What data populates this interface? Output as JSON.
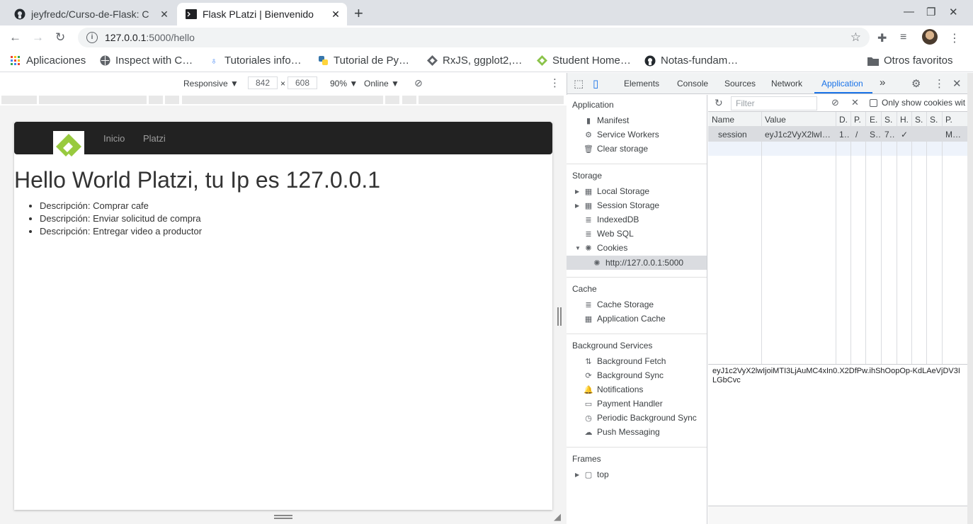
{
  "browser": {
    "tabs": [
      {
        "title": "jeyfredc/Curso-de-Flask: C",
        "icon": "github-icon",
        "active": false
      },
      {
        "title": "Flask PLatzi | Bienvenido",
        "icon": "terminal-icon",
        "active": true
      }
    ],
    "new_tab": "+",
    "url_host": "127.0.0.1",
    "url_path": ":5000/hello"
  },
  "bookmarks": [
    {
      "label": "Aplicaciones",
      "icon": "apps-grid-icon"
    },
    {
      "label": "Inspect with C…",
      "icon": "globe-icon"
    },
    {
      "label": "Tutoriales info…",
      "icon": "bulb-icon"
    },
    {
      "label": "Tutorial de Py…",
      "icon": "python-icon"
    },
    {
      "label": "RxJS, ggplot2,…",
      "icon": "diamond-icon"
    },
    {
      "label": "Student Home…",
      "icon": "student-diamond-icon"
    },
    {
      "label": "Notas-fundam…",
      "icon": "github-icon"
    },
    {
      "label": "Otros favoritos",
      "icon": "folder-icon"
    }
  ],
  "device_toolbar": {
    "mode": "Responsive ▼",
    "width": "842",
    "times": "×",
    "height": "608",
    "zoom": "90% ▼",
    "network": "Online ▼"
  },
  "site": {
    "nav_links": [
      "Inicio",
      "Platzi"
    ],
    "heading": "Hello World Platzi, tu Ip es 127.0.0.1",
    "todos": [
      "Descripción: Comprar cafe",
      "Descripción: Enviar solicitud de compra",
      "Descripción: Entregar video a productor"
    ]
  },
  "devtools": {
    "tabs": [
      "Elements",
      "Console",
      "Sources",
      "Network",
      "Application"
    ],
    "active_tab": "Application",
    "more": "»"
  },
  "sidebar": {
    "sections": {
      "application": "Application",
      "storage": "Storage",
      "cache": "Cache",
      "background": "Background Services",
      "frames": "Frames"
    },
    "application_items": [
      "Manifest",
      "Service Workers",
      "Clear storage"
    ],
    "storage_items": [
      "Local Storage",
      "Session Storage",
      "IndexedDB",
      "Web SQL",
      "Cookies"
    ],
    "cookie_origin": "http://127.0.0.1:5000",
    "cache_items": [
      "Cache Storage",
      "Application Cache"
    ],
    "background_items": [
      "Background Fetch",
      "Background Sync",
      "Notifications",
      "Payment Handler",
      "Periodic Background Sync",
      "Push Messaging"
    ],
    "frames_items": [
      "top"
    ]
  },
  "cookies": {
    "filter_placeholder": "Filter",
    "only_show_label": "Only show cookies wit",
    "columns": [
      "Name",
      "Value",
      "D.",
      "P.",
      "E.",
      "S.",
      "H.",
      "S.",
      "S.",
      "P."
    ],
    "row": [
      "session",
      "eyJ1c2VyX2lwI…",
      "1…",
      "/",
      "S…",
      "7…",
      "✓",
      "",
      "",
      "M…"
    ],
    "full_value": "eyJ1c2VyX2lwIjoiMTI3LjAuMC4xIn0.X2DfPw.ihShOopOp-KdLAeVjDV3ILGbCvc"
  }
}
